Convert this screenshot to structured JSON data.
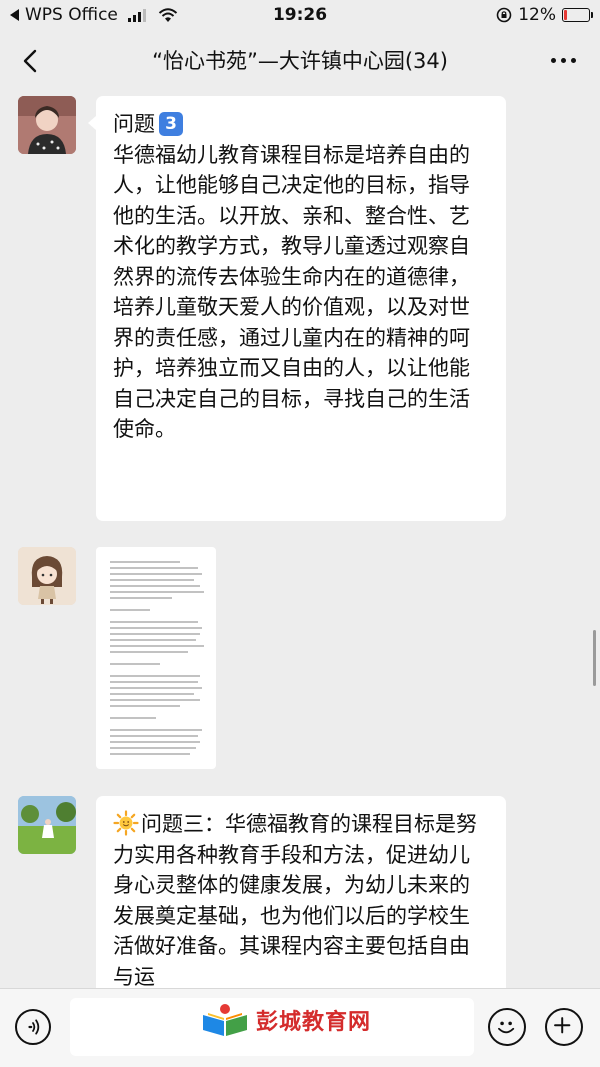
{
  "status_bar": {
    "carrier": "WPS Office",
    "time": "19:26",
    "battery": "12%",
    "battery_level": 0.12
  },
  "header": {
    "title": "“怡心书苑”—大许镇中心园(34)"
  },
  "messages": [
    {
      "heading_label": "问题",
      "heading_badge": "3",
      "text": "华德福幼儿教育课程目标是培养自由的人，让他能够自己决定他的目标，指导他的生活。以开放、亲和、整合性、艺术化的教学方式，教导儿童透过观察自然界的流传去体验生命内在的道德律，培养儿童敬天爱人的价值观，以及对世界的责任感，通过儿童内在的精神的呵护，培养独立而又自由的人，以让他能自己决定自己的目标，寻找自己的生活使命。"
    },
    {
      "type": "document-image"
    },
    {
      "heading_label": "问题三：",
      "text": "华德福教育的课程目标是努力实用各种教育手段和方法，促进幼儿身心灵整体的健康发展，为幼儿未来的发展奠定基础，也为他们以后的学校生活做好准备。其课程内容主要包括自由与运"
    }
  ],
  "watermark": {
    "text": "彭城教育网"
  },
  "colors": {
    "chat_background": "#ededed",
    "bubble": "#ffffff",
    "badge_blue": "#3f7fe0",
    "watermark_red": "#d42c2c",
    "battery_red": "#e53935"
  },
  "icons": {
    "back": "chevron-left-icon",
    "more": "more-dots-icon",
    "voice": "voice-icon",
    "emoji": "emoji-icon",
    "add": "plus-icon"
  }
}
